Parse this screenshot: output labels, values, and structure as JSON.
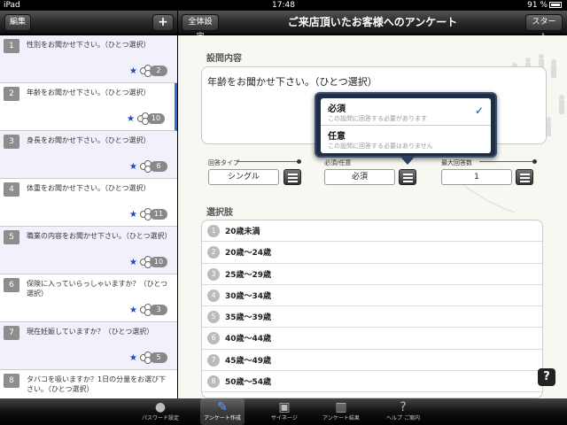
{
  "statusbar": {
    "device": "iPad",
    "time": "17:48",
    "battery": "91 %"
  },
  "left_header": {
    "edit_label": "編集",
    "add_label": "+"
  },
  "right_header": {
    "all_settings_label": "全体設定",
    "title": "ご来店頂いたお客様へのアンケート",
    "start_label": "スタート"
  },
  "questions": [
    {
      "num": "1",
      "text": "性別をお聞かせ下さい。（ひとつ選択）",
      "count": "2"
    },
    {
      "num": "2",
      "text": "年齢をお聞かせ下さい。（ひとつ選択）",
      "count": "10"
    },
    {
      "num": "3",
      "text": "身長をお聞かせ下さい。（ひとつ選択）",
      "count": "6"
    },
    {
      "num": "4",
      "text": "体重をお聞かせ下さい。（ひとつ選択）",
      "count": "11"
    },
    {
      "num": "5",
      "text": "職業の内容をお聞かせ下さい。（ひとつ選択）",
      "count": "10"
    },
    {
      "num": "6",
      "text": "保険に入っていらっしゃいますか？（ひとつ選択）",
      "count": "3"
    },
    {
      "num": "7",
      "text": "現在妊娠していますか？（ひとつ選択）",
      "count": "5"
    },
    {
      "num": "8",
      "text": "タバコを吸いますか？1日の分量をお選び下さい。（ひとつ選択）",
      "count": ""
    }
  ],
  "detail": {
    "content_label": "設問内容",
    "question_text": "年齢をお聞かせ下さい。（ひとつ選択）",
    "answer_type_label": "回答タイプ",
    "answer_type_value": "シングル",
    "required_label": "必須/任意",
    "required_value": "必須",
    "max_answers_label": "最大回答数",
    "max_answers_value": "1",
    "choices_label": "選択肢",
    "choices": [
      {
        "num": "1",
        "text": "20歳未満"
      },
      {
        "num": "2",
        "text": "20歳〜24歳"
      },
      {
        "num": "3",
        "text": "25歳〜29歳"
      },
      {
        "num": "4",
        "text": "30歳〜34歳"
      },
      {
        "num": "5",
        "text": "35歳〜39歳"
      },
      {
        "num": "6",
        "text": "40歳〜44歳"
      },
      {
        "num": "7",
        "text": "45歳〜49歳"
      },
      {
        "num": "8",
        "text": "50歳〜54歳"
      }
    ],
    "help_label": "?"
  },
  "popover": {
    "options": [
      {
        "title": "必須",
        "subtitle": "この設問に回答する必要があります",
        "checked": "✓"
      },
      {
        "title": "任意",
        "subtitle": "この設問に回答する必要はありません",
        "checked": ""
      }
    ]
  },
  "tabs": [
    {
      "label": "パスワード設定",
      "icon": "person-icon"
    },
    {
      "label": "アンケート作成",
      "icon": "edit-icon"
    },
    {
      "label": "サイネージ",
      "icon": "signage-icon"
    },
    {
      "label": "アンケート結果",
      "icon": "chart-icon"
    },
    {
      "label": "ヘルプ ご案内",
      "icon": "help-icon"
    }
  ],
  "colors": {
    "accent": "#2b6fd6",
    "star": "#1a46c8",
    "popover_bg": "#1f2d44"
  }
}
